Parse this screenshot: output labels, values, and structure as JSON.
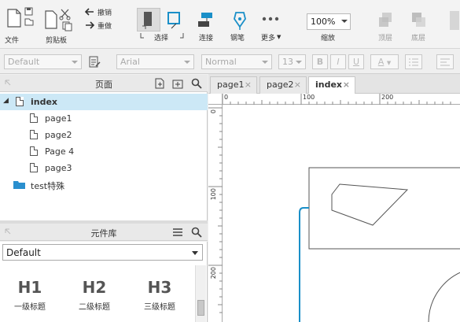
{
  "toolbar": {
    "file_label": "文件",
    "clipboard_label": "剪贴板",
    "undo_label": "撤销",
    "redo_label": "重做",
    "select_label": "选择",
    "connect_label": "连接",
    "pen_label": "钢笔",
    "more_label": "更多",
    "zoom_value": "100%",
    "zoom_label": "缩放",
    "top_label": "顶层",
    "bottom_label": "底层"
  },
  "formatbar": {
    "style_value": "Default",
    "font_value": "Arial",
    "weight_value": "Normal",
    "size_value": "13",
    "bold": "B",
    "italic": "I",
    "underline": "U",
    "font_color": "A"
  },
  "pages_panel": {
    "title": "页面",
    "items": [
      {
        "label": "index",
        "level": 0,
        "selected": true
      },
      {
        "label": "page1",
        "level": 1
      },
      {
        "label": "page2",
        "level": 1
      },
      {
        "label": "Page 4",
        "level": 1
      },
      {
        "label": "page3",
        "level": 1
      },
      {
        "label": "test特殊",
        "level": 0,
        "folder": true
      }
    ]
  },
  "library_panel": {
    "title": "元件库",
    "selected_library": "Default",
    "widgets": [
      {
        "big": "H1",
        "label": "一级标题"
      },
      {
        "big": "H2",
        "label": "二级标题"
      },
      {
        "big": "H3",
        "label": "三级标题"
      }
    ]
  },
  "tabs": [
    {
      "label": "page1",
      "close": "×"
    },
    {
      "label": "page2",
      "close": "×"
    },
    {
      "label": "index",
      "close": "×",
      "active": true
    }
  ],
  "ruler": {
    "h_ticks": [
      "0",
      "100",
      "200"
    ],
    "v_ticks": [
      "0",
      "100",
      "200"
    ]
  },
  "colors": {
    "accent": "#1a8fc8",
    "selected_row": "#cce8f6"
  }
}
